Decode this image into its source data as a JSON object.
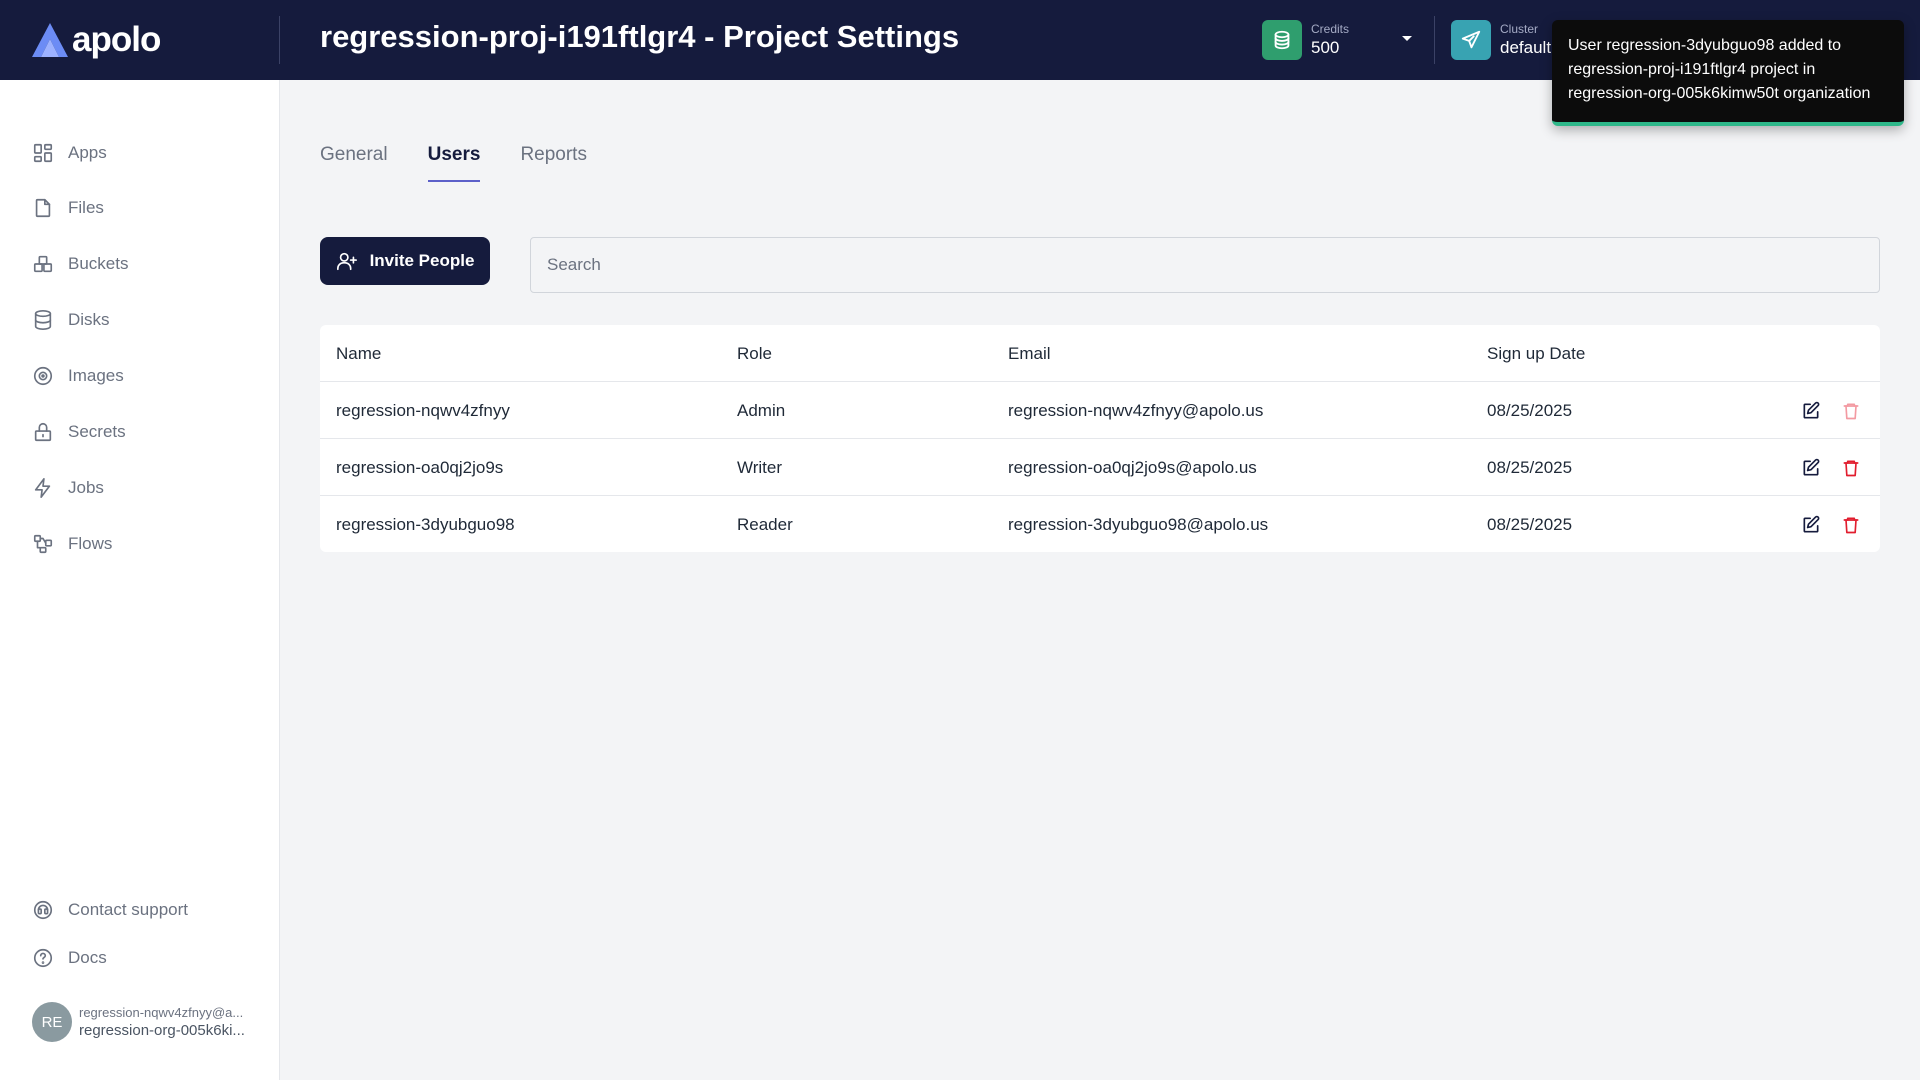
{
  "header": {
    "logo_text": "apolo",
    "title": "regression-proj-i191ftlgr4 - Project Settings",
    "credits": {
      "label": "Credits",
      "value": "500",
      "icon": "coins-icon"
    },
    "cluster": {
      "label": "Cluster",
      "value": "default",
      "icon": "send-icon"
    }
  },
  "toast": {
    "message": "User regression-3dyubguo98 added to regression-proj-i191ftlgr4 project in regression-org-005k6kimw50t organization"
  },
  "sidebar": {
    "items": [
      {
        "label": "Apps",
        "icon": "apps-grid-icon"
      },
      {
        "label": "Files",
        "icon": "file-icon"
      },
      {
        "label": "Buckets",
        "icon": "bucket-icon"
      },
      {
        "label": "Disks",
        "icon": "database-icon"
      },
      {
        "label": "Images",
        "icon": "image-disc-icon"
      },
      {
        "label": "Secrets",
        "icon": "lock-icon"
      },
      {
        "label": "Jobs",
        "icon": "lightning-icon"
      },
      {
        "label": "Flows",
        "icon": "flow-icon"
      }
    ],
    "footer": [
      {
        "label": "Contact support",
        "icon": "headset-icon"
      },
      {
        "label": "Docs",
        "icon": "help-circle-icon"
      }
    ],
    "user": {
      "initials": "RE",
      "email": "regression-nqwv4zfnyy@a...",
      "org": "regression-org-005k6ki..."
    }
  },
  "tabs": [
    {
      "label": "General",
      "active": false
    },
    {
      "label": "Users",
      "active": true
    },
    {
      "label": "Reports",
      "active": false
    }
  ],
  "toolbar": {
    "invite_label": "Invite People",
    "search_placeholder": "Search"
  },
  "table": {
    "columns": [
      "Name",
      "Role",
      "Email",
      "Sign up Date"
    ],
    "rows": [
      {
        "name": "regression-nqwv4zfnyy",
        "role": "Admin",
        "email": "regression-nqwv4zfnyy@apolo.us",
        "date": "08/25/2025",
        "delete_enabled": false
      },
      {
        "name": "regression-oa0qj2jo9s",
        "role": "Writer",
        "email": "regression-oa0qj2jo9s@apolo.us",
        "date": "08/25/2025",
        "delete_enabled": true
      },
      {
        "name": "regression-3dyubguo98",
        "role": "Reader",
        "email": "regression-3dyubguo98@apolo.us",
        "date": "08/25/2025",
        "delete_enabled": true
      }
    ]
  },
  "colors": {
    "header_bg": "#151b3d",
    "accent": "#5c60c9",
    "credits_badge": "#2f9e6e",
    "cluster_badge": "#38a3b2",
    "delete": "#e11d2e",
    "toast_border": "#2fb88a"
  }
}
